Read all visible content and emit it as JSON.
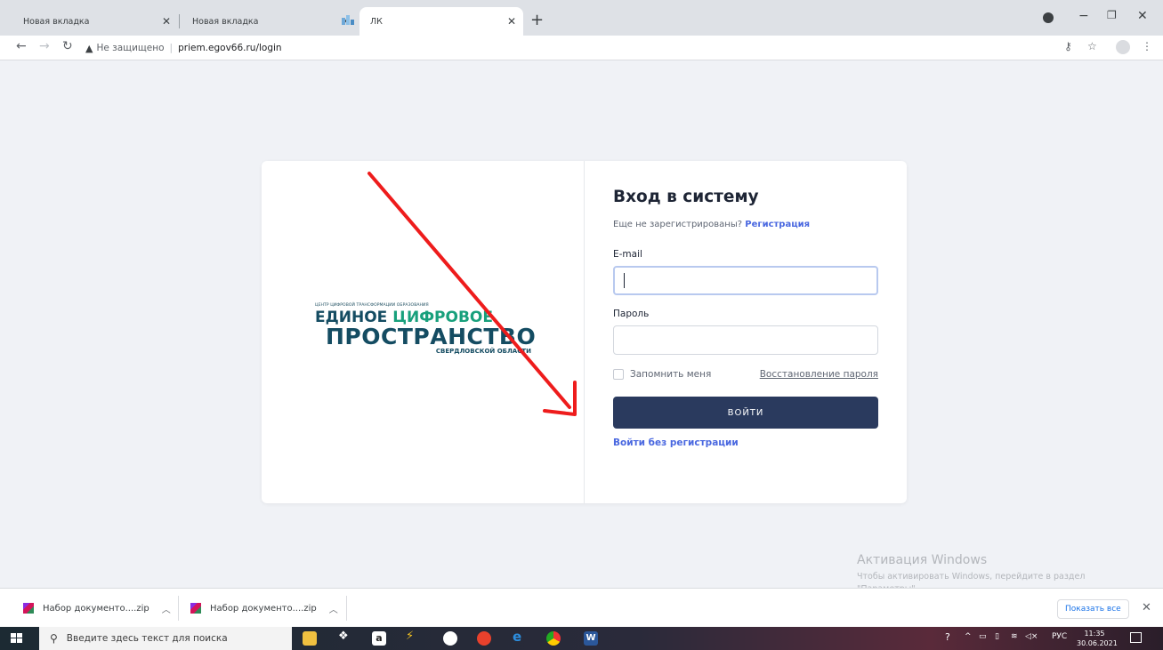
{
  "browser": {
    "tabs": [
      {
        "title": "Новая вкладка"
      },
      {
        "title": "Новая вкладка"
      },
      {
        "title": "ЛК"
      }
    ],
    "address": {
      "security_label": "Не защищено",
      "url": "priem.egov66.ru/login"
    }
  },
  "logo": {
    "caption": "ЦЕНТР ЦИФРОВОЙ ТРАНСФОРМАЦИИ ОБРАЗОВАНИЯ",
    "word1": "ЕДИНОЕ",
    "word2": "ЦИФРОВОЕ",
    "word3": "ПРОСТРАНСТВО",
    "word4": "СВЕРДЛОВСКОЙ ОБЛАСТИ",
    "colors": {
      "dark": "#144c62",
      "green": "#18a07c"
    }
  },
  "login": {
    "title": "Вход в систему",
    "not_registered": "Еще не зарегистрированы?",
    "register_link": "Регистрация",
    "email_label": "E-mail",
    "email_value": "",
    "password_label": "Пароль",
    "password_value": "",
    "remember_label": "Запомнить меня",
    "restore_link": "Восстановление пароля",
    "submit_label": "ВОЙТИ",
    "guest_link": "Войти без регистрации",
    "colors": {
      "button": "#2a3a5e",
      "link": "#4a68e0"
    }
  },
  "watermark": {
    "title": "Активация Windows",
    "text": "Чтобы активировать Windows, перейдите в раздел \"Параметры\"."
  },
  "downloads": {
    "items": [
      {
        "name": "Набор документо....zip"
      },
      {
        "name": "Набор документо....zip"
      }
    ],
    "show_all": "Показать все"
  },
  "taskbar": {
    "search_placeholder": "Введите здесь текст для поиска",
    "language": "РУС",
    "time": "11:35",
    "date": "30.06.2021"
  },
  "annotation": {
    "color": "#ee1c1c"
  }
}
